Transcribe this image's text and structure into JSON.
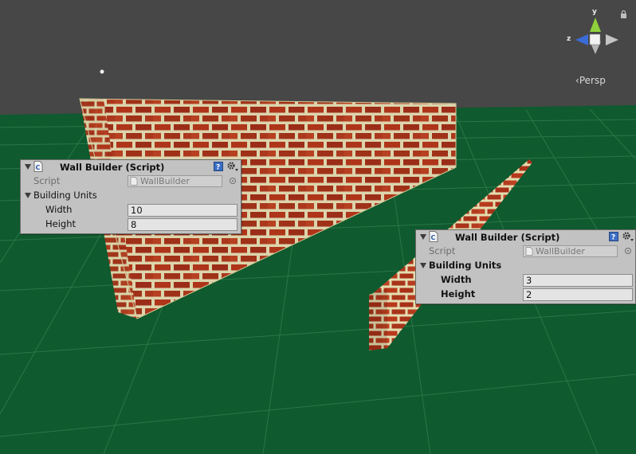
{
  "scene": {
    "sky_color": "#474747",
    "ground_color": "#0f5a2e",
    "view_mode": "Persp",
    "axes": {
      "x": "x",
      "y": "y",
      "z": "z"
    }
  },
  "inspectors": [
    {
      "title": "Wall Builder (Script)",
      "script_label": "Script",
      "script_value": "WallBuilder",
      "section_label": "Building Units",
      "width_label": "Width",
      "width_value": "10",
      "height_label": "Height",
      "height_value": "8"
    },
    {
      "title": "Wall Builder (Script)",
      "script_label": "Script",
      "script_value": "WallBuilder",
      "section_label": "Building Units",
      "width_label": "Width",
      "width_value": "3",
      "height_label": "Height",
      "height_value": "2"
    }
  ]
}
